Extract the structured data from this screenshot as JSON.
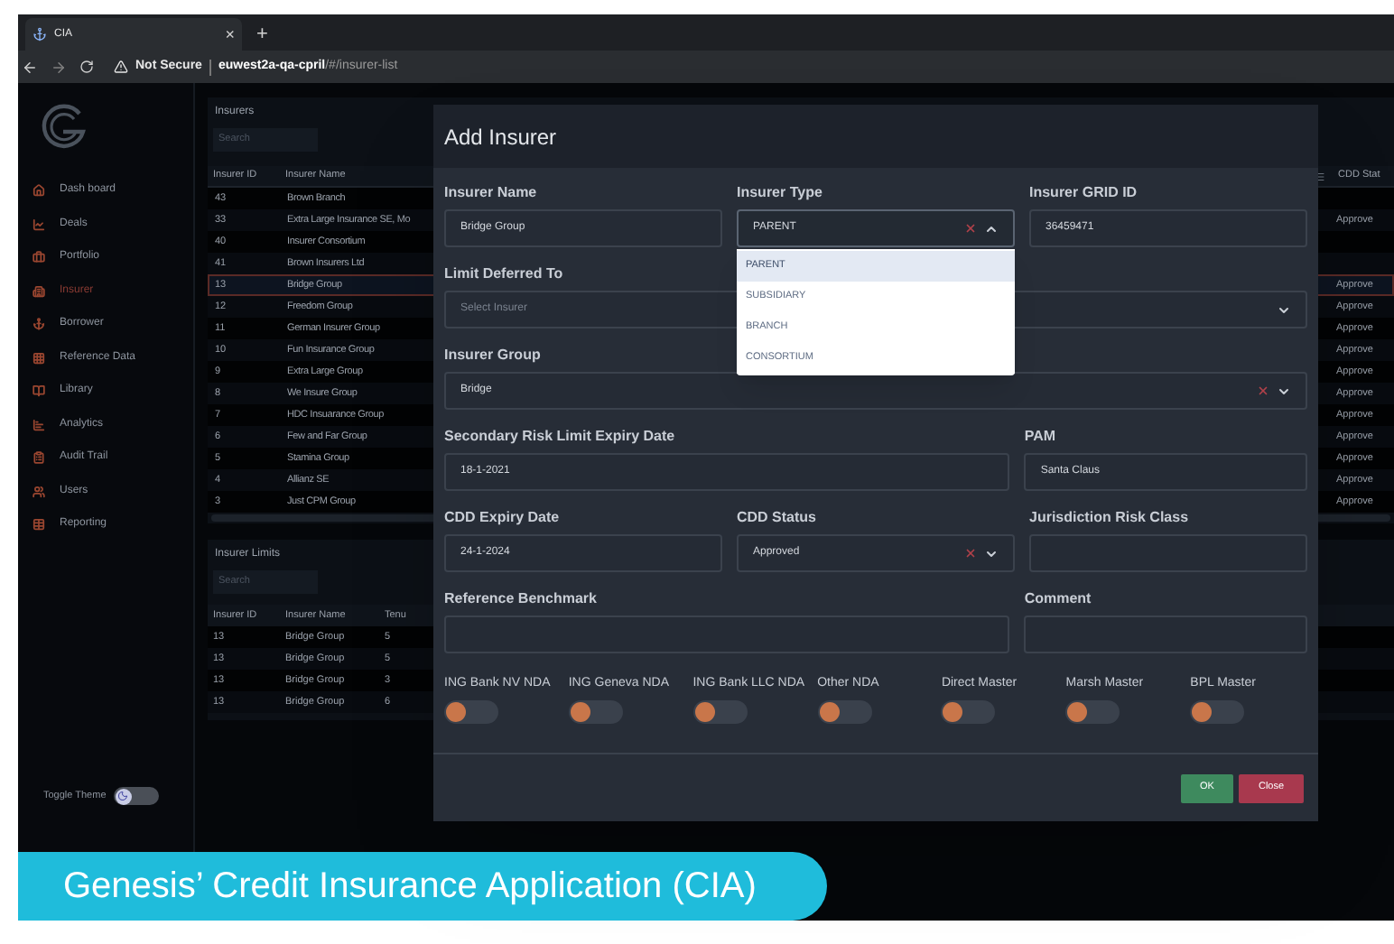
{
  "browser": {
    "tab_title": "CIA",
    "close": "×",
    "new_tab": "+",
    "security": "Not Secure",
    "url_host": "euwest2a-qa-cpril",
    "url_path": "/#/insurer-list"
  },
  "sidebar": {
    "items": [
      {
        "label": "Dash board",
        "selected": false
      },
      {
        "label": "Deals",
        "selected": false
      },
      {
        "label": "Portfolio",
        "selected": false
      },
      {
        "label": "Insurer",
        "selected": true
      },
      {
        "label": "Borrower",
        "selected": false
      },
      {
        "label": "Reference Data",
        "selected": false
      },
      {
        "label": "Library",
        "selected": false
      },
      {
        "label": "Analytics",
        "selected": false
      },
      {
        "label": "Audit Trail",
        "selected": false
      },
      {
        "label": "Users",
        "selected": false
      },
      {
        "label": "Reporting",
        "selected": false
      }
    ],
    "theme_toggle": {
      "label": "Toggle Theme",
      "on": false
    }
  },
  "insurers": {
    "title": "Insurers",
    "search_placeholder": "Search",
    "columns": [
      "Insurer ID",
      "Insurer Name",
      "CDD Stat"
    ],
    "rows": [
      {
        "id": "43",
        "name": "Brown Branch",
        "selected": false
      },
      {
        "id": "33",
        "name": "Extra Large Insurance SE, Mo",
        "cdd_status": "Approve",
        "selected": false
      },
      {
        "id": "40",
        "name": "Insurer Consortium",
        "selected": false
      },
      {
        "id": "41",
        "name": "Brown Insurers Ltd",
        "selected": false
      },
      {
        "id": "13",
        "name": "Bridge Group",
        "cdd_status": "Approve",
        "selected": true
      },
      {
        "id": "12",
        "name": "Freedom Group",
        "cdd_status": "Approve",
        "selected": false
      },
      {
        "id": "11",
        "name": "German Insurer Group",
        "cdd_status": "Approve",
        "selected": false
      },
      {
        "id": "10",
        "name": "Fun Insurance Group",
        "cdd_status": "Approve",
        "selected": false
      },
      {
        "id": "9",
        "name": "Extra Large Group",
        "cdd_status": "Approve",
        "selected": false
      },
      {
        "id": "8",
        "name": "We Insure Group",
        "cdd_status": "Approve",
        "selected": false
      },
      {
        "id": "7",
        "name": "HDC Insuarance Group",
        "cdd_status": "Approve",
        "selected": false
      },
      {
        "id": "6",
        "name": "Few and Far Group",
        "cdd_status": "Approve",
        "selected": false
      },
      {
        "id": "5",
        "name": "Stamina Group",
        "cdd_status": "Approve",
        "selected": false
      },
      {
        "id": "4",
        "name": "Allianz SE",
        "cdd_status": "Approve",
        "selected": false
      },
      {
        "id": "3",
        "name": "Just CPM Group",
        "cdd_status": "Approve",
        "selected": false
      }
    ]
  },
  "limits": {
    "title": "Insurer Limits",
    "search_placeholder": "Search",
    "columns": [
      "Insurer ID",
      "Insurer Name",
      "Tenu"
    ],
    "rows": [
      {
        "id": "13",
        "name": "Bridge Group",
        "tenor": "5"
      },
      {
        "id": "13",
        "name": "Bridge Group",
        "tenor": "5"
      },
      {
        "id": "13",
        "name": "Bridge Group",
        "tenor": "3"
      },
      {
        "id": "13",
        "name": "Bridge Group",
        "tenor": "6"
      }
    ]
  },
  "modal": {
    "title": "Add Insurer",
    "rows": [
      [
        {
          "label": "Insurer Name",
          "kind": "text",
          "value": "Bridge Group"
        },
        {
          "label": "Insurer Type",
          "kind": "select",
          "value": "PARENT",
          "clearable": true,
          "open": true,
          "options": [
            {
              "label": "PARENT",
              "selected": true
            },
            {
              "label": "SUBSIDIARY",
              "selected": false
            },
            {
              "label": "BRANCH",
              "selected": false
            },
            {
              "label": "CONSORTIUM",
              "selected": false
            }
          ]
        },
        {
          "label": "Insurer GRID ID",
          "kind": "text",
          "value": "36459471"
        }
      ],
      [
        {
          "label": "Limit Deferred To",
          "kind": "select",
          "placeholder": "Select Insurer",
          "open": false
        }
      ],
      [
        {
          "label": "Insurer Group",
          "kind": "select",
          "value": "Bridge",
          "clearable": true,
          "open": false
        }
      ],
      [
        {
          "label": "Secondary Risk Limit Expiry Date",
          "kind": "text",
          "value": "18-1-2021"
        },
        {
          "label": "PAM",
          "kind": "text",
          "value": "Santa Claus"
        }
      ],
      [
        {
          "label": "CDD Expiry Date",
          "kind": "text",
          "value": "24-1-2024"
        },
        {
          "label": "CDD Status",
          "kind": "select",
          "value": "Approved",
          "clearable": true,
          "open": false
        },
        {
          "label": "Jurisdiction Risk Class",
          "kind": "text"
        }
      ],
      [
        {
          "label": "Reference Benchmark",
          "kind": "text"
        },
        {
          "label": "Comment",
          "kind": "text"
        }
      ]
    ],
    "toggles": [
      {
        "label": "ING Bank NV NDA",
        "on": false
      },
      {
        "label": "ING Geneva NDA",
        "on": false
      },
      {
        "label": "ING Bank LLC NDA",
        "on": false
      },
      {
        "label": "Other NDA",
        "on": false
      },
      {
        "label": "Direct Master",
        "on": false
      },
      {
        "label": "Marsh Master",
        "on": false
      },
      {
        "label": "BPL Master",
        "on": false
      }
    ],
    "buttons": [
      {
        "label": "OK",
        "kind": "primary"
      },
      {
        "label": "Close",
        "kind": "danger"
      }
    ]
  },
  "caption": "Genesis’ Credit Insurance Application (CIA)"
}
